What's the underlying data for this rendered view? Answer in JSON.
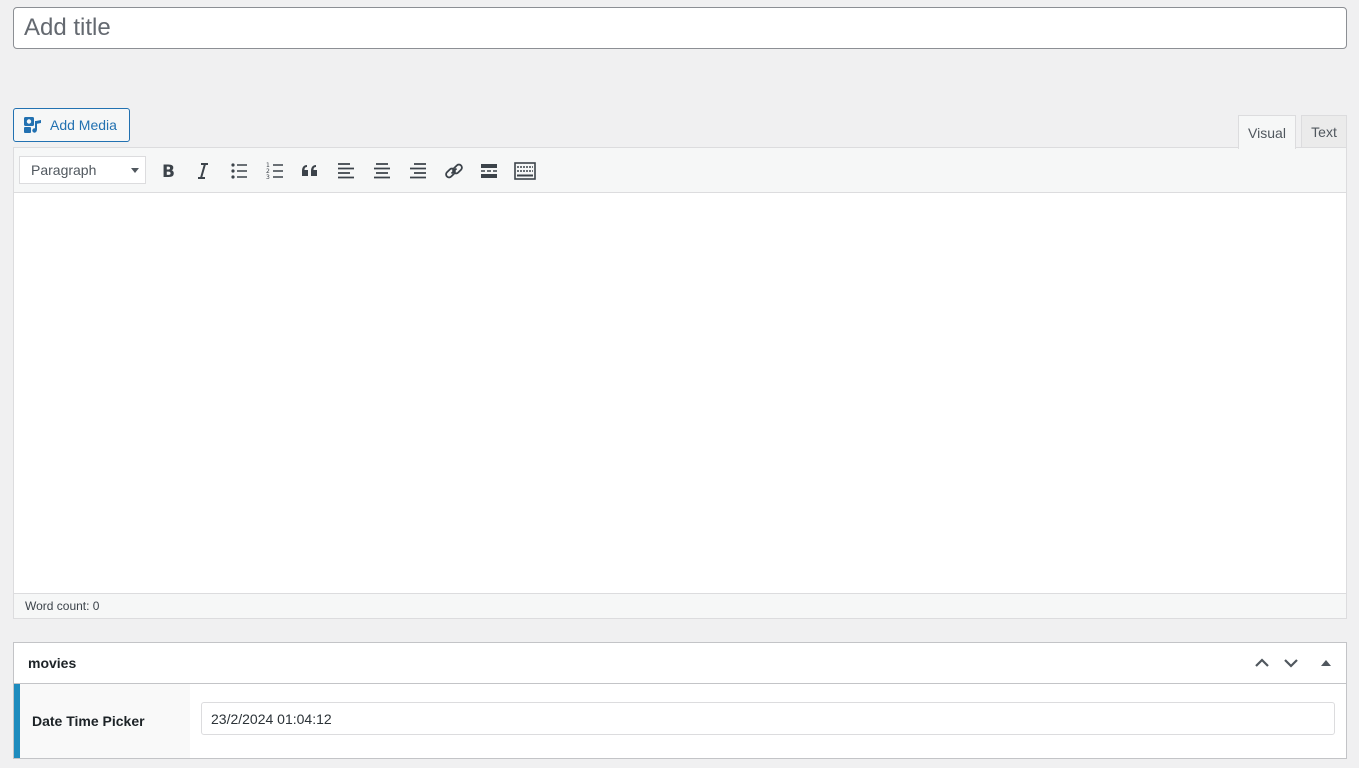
{
  "title_field": {
    "placeholder": "Add title",
    "value": ""
  },
  "media": {
    "add_media_label": "Add Media"
  },
  "editor_tabs": {
    "visual": "Visual",
    "text": "Text",
    "active": "Visual"
  },
  "toolbar": {
    "format_select": {
      "selected": "Paragraph"
    },
    "buttons": [
      "bold-icon",
      "italic-icon",
      "bulleted-list-icon",
      "numbered-list-icon",
      "blockquote-icon",
      "align-left-icon",
      "align-center-icon",
      "align-right-icon",
      "link-icon",
      "read-more-icon",
      "toolbar-toggle-icon"
    ]
  },
  "editor": {
    "word_count": "Word count: 0"
  },
  "metabox": {
    "title": "movies",
    "field_label": "Date Time Picker",
    "field_value": "23/2/2024 01:04:12"
  },
  "colors": {
    "accent": "#2271b1",
    "field_marker": "#1e8cbe",
    "background": "#f0f0f1"
  }
}
